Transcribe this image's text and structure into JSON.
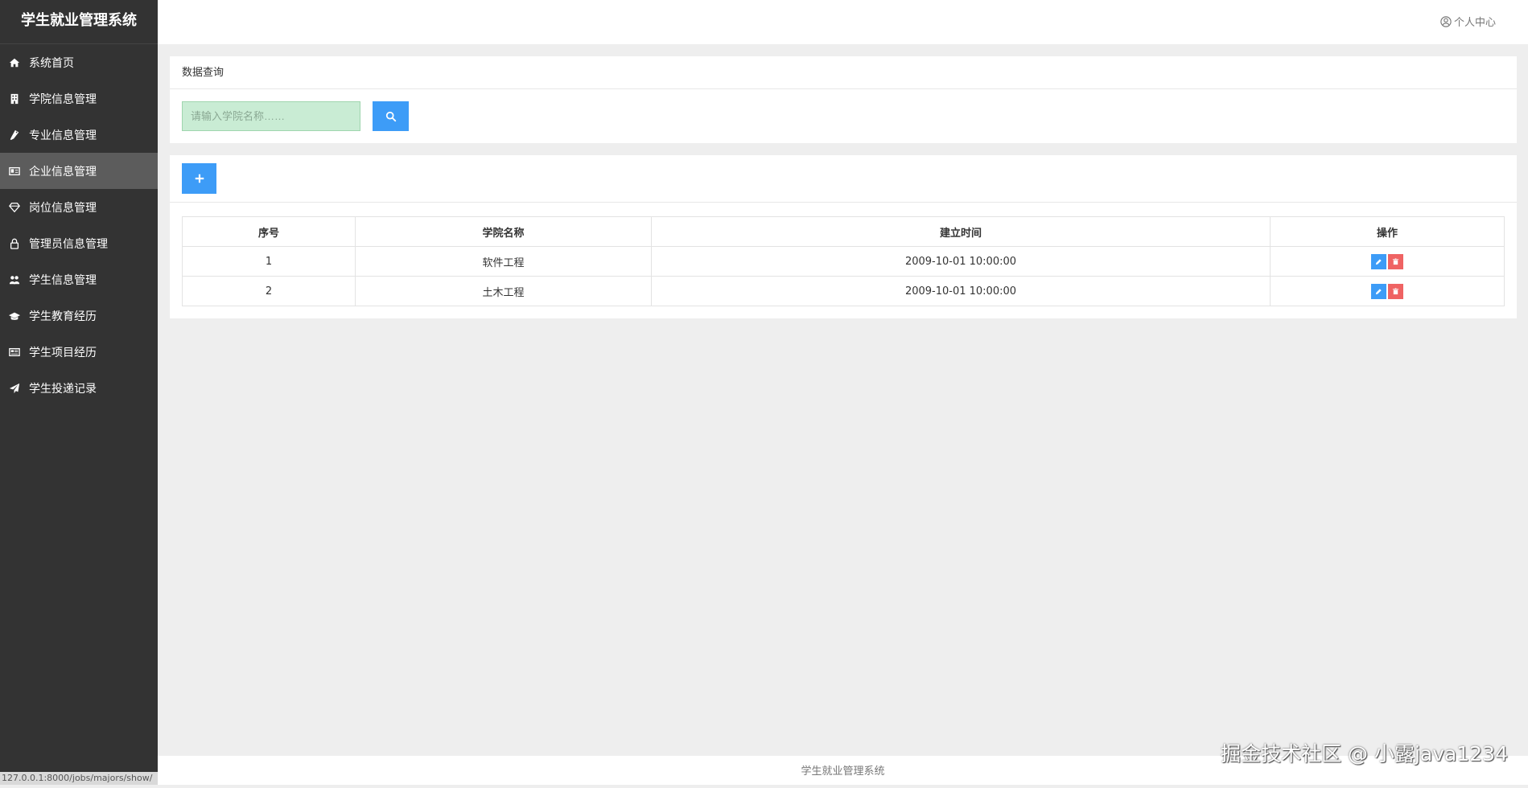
{
  "app": {
    "title": "学生就业管理系统"
  },
  "sidebar": {
    "items": [
      {
        "label": "系统首页",
        "icon": "home-icon"
      },
      {
        "label": "学院信息管理",
        "icon": "building-icon"
      },
      {
        "label": "专业信息管理",
        "icon": "flask-icon"
      },
      {
        "label": "企业信息管理",
        "icon": "id-card-icon",
        "active": true
      },
      {
        "label": "岗位信息管理",
        "icon": "diamond-icon"
      },
      {
        "label": "管理员信息管理",
        "icon": "lock-icon"
      },
      {
        "label": "学生信息管理",
        "icon": "users-icon"
      },
      {
        "label": "学生教育经历",
        "icon": "graduation-cap-icon"
      },
      {
        "label": "学生项目经历",
        "icon": "newspaper-icon"
      },
      {
        "label": "学生投递记录",
        "icon": "paper-plane-icon"
      }
    ]
  },
  "header": {
    "user_center_label": "个人中心"
  },
  "query": {
    "title": "数据查询",
    "placeholder": "请输入学院名称……"
  },
  "table": {
    "columns": [
      "序号",
      "学院名称",
      "建立时间",
      "操作"
    ],
    "rows": [
      {
        "index": "1",
        "name": "软件工程",
        "created": "2009-10-01 10:00:00"
      },
      {
        "index": "2",
        "name": "土木工程",
        "created": "2009-10-01 10:00:00"
      }
    ]
  },
  "footer": {
    "text": "学生就业管理系统"
  },
  "status_bar": {
    "url": "127.0.0.1:8000/jobs/majors/show/"
  },
  "watermark": {
    "text": "掘金技术社区 @ 小露java1234"
  },
  "colors": {
    "sidebar_bg": "#333333",
    "active_item_bg": "#5c5c5c",
    "primary": "#3d9cf7",
    "danger": "#ef6363",
    "search_bg": "#c9ecd4"
  }
}
